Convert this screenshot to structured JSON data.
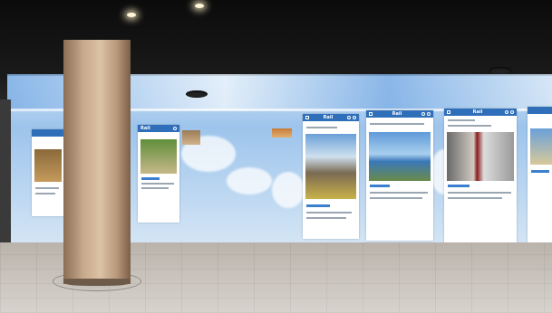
{
  "scene": {
    "screens": [
      {
        "brand": "Rail"
      },
      {
        "brand": "Rail"
      },
      {
        "brand": "Rail"
      },
      {
        "brand": "Rail"
      }
    ]
  },
  "colors": {
    "accent": "#2f6fb9",
    "sky": "#9dc4ec",
    "pillar": "#c8aa8c",
    "floor": "#c9c3bc"
  }
}
